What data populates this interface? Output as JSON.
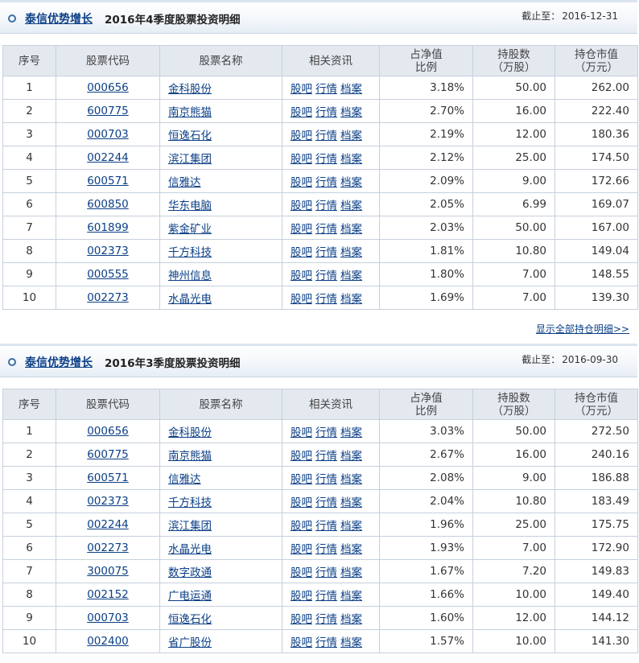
{
  "columns": {
    "idx": "序号",
    "code": "股票代码",
    "name": "股票名称",
    "info": "相关资讯",
    "ratio_l1": "占净值",
    "ratio_l2": "比例",
    "shares_l1": "持股数",
    "shares_l2": "（万股）",
    "value_l1": "持仓市值",
    "value_l2": "（万元）"
  },
  "link_labels": [
    "股吧",
    "行情",
    "档案"
  ],
  "more_link": "显示全部持仓明细>>",
  "sections": [
    {
      "fund_name": "泰信优势增长",
      "title_rest": "2016年4季度股票投资明细",
      "cutoff_label": "截止至：",
      "cutoff_date": "2016-12-31",
      "rows": [
        {
          "idx": "1",
          "code": "000656",
          "name": "金科股份",
          "ratio": "3.18%",
          "shares": "50.00",
          "value": "262.00"
        },
        {
          "idx": "2",
          "code": "600775",
          "name": "南京熊猫",
          "ratio": "2.70%",
          "shares": "16.00",
          "value": "222.40"
        },
        {
          "idx": "3",
          "code": "000703",
          "name": "恒逸石化",
          "ratio": "2.19%",
          "shares": "12.00",
          "value": "180.36"
        },
        {
          "idx": "4",
          "code": "002244",
          "name": "滨江集团",
          "ratio": "2.12%",
          "shares": "25.00",
          "value": "174.50"
        },
        {
          "idx": "5",
          "code": "600571",
          "name": "信雅达",
          "ratio": "2.09%",
          "shares": "9.00",
          "value": "172.66"
        },
        {
          "idx": "6",
          "code": "600850",
          "name": "华东电脑",
          "ratio": "2.05%",
          "shares": "6.99",
          "value": "169.07"
        },
        {
          "idx": "7",
          "code": "601899",
          "name": "紫金矿业",
          "ratio": "2.03%",
          "shares": "50.00",
          "value": "167.00"
        },
        {
          "idx": "8",
          "code": "002373",
          "name": "千方科技",
          "ratio": "1.81%",
          "shares": "10.80",
          "value": "149.04"
        },
        {
          "idx": "9",
          "code": "000555",
          "name": "神州信息",
          "ratio": "1.80%",
          "shares": "7.00",
          "value": "148.55"
        },
        {
          "idx": "10",
          "code": "002273",
          "name": "水晶光电",
          "ratio": "1.69%",
          "shares": "7.00",
          "value": "139.30"
        }
      ]
    },
    {
      "fund_name": "泰信优势增长",
      "title_rest": "2016年3季度股票投资明细",
      "cutoff_label": "截止至：",
      "cutoff_date": "2016-09-30",
      "rows": [
        {
          "idx": "1",
          "code": "000656",
          "name": "金科股份",
          "ratio": "3.03%",
          "shares": "50.00",
          "value": "272.50"
        },
        {
          "idx": "2",
          "code": "600775",
          "name": "南京熊猫",
          "ratio": "2.67%",
          "shares": "16.00",
          "value": "240.16"
        },
        {
          "idx": "3",
          "code": "600571",
          "name": "信雅达",
          "ratio": "2.08%",
          "shares": "9.00",
          "value": "186.88"
        },
        {
          "idx": "4",
          "code": "002373",
          "name": "千方科技",
          "ratio": "2.04%",
          "shares": "10.80",
          "value": "183.49"
        },
        {
          "idx": "5",
          "code": "002244",
          "name": "滨江集团",
          "ratio": "1.96%",
          "shares": "25.00",
          "value": "175.75"
        },
        {
          "idx": "6",
          "code": "002273",
          "name": "水晶光电",
          "ratio": "1.93%",
          "shares": "7.00",
          "value": "172.90"
        },
        {
          "idx": "7",
          "code": "300075",
          "name": "数字政通",
          "ratio": "1.67%",
          "shares": "7.20",
          "value": "149.83"
        },
        {
          "idx": "8",
          "code": "002152",
          "name": "广电运通",
          "ratio": "1.66%",
          "shares": "10.00",
          "value": "149.40"
        },
        {
          "idx": "9",
          "code": "000703",
          "name": "恒逸石化",
          "ratio": "1.60%",
          "shares": "12.00",
          "value": "144.12"
        },
        {
          "idx": "10",
          "code": "002400",
          "name": "省广股份",
          "ratio": "1.57%",
          "shares": "10.00",
          "value": "141.30"
        }
      ]
    }
  ]
}
